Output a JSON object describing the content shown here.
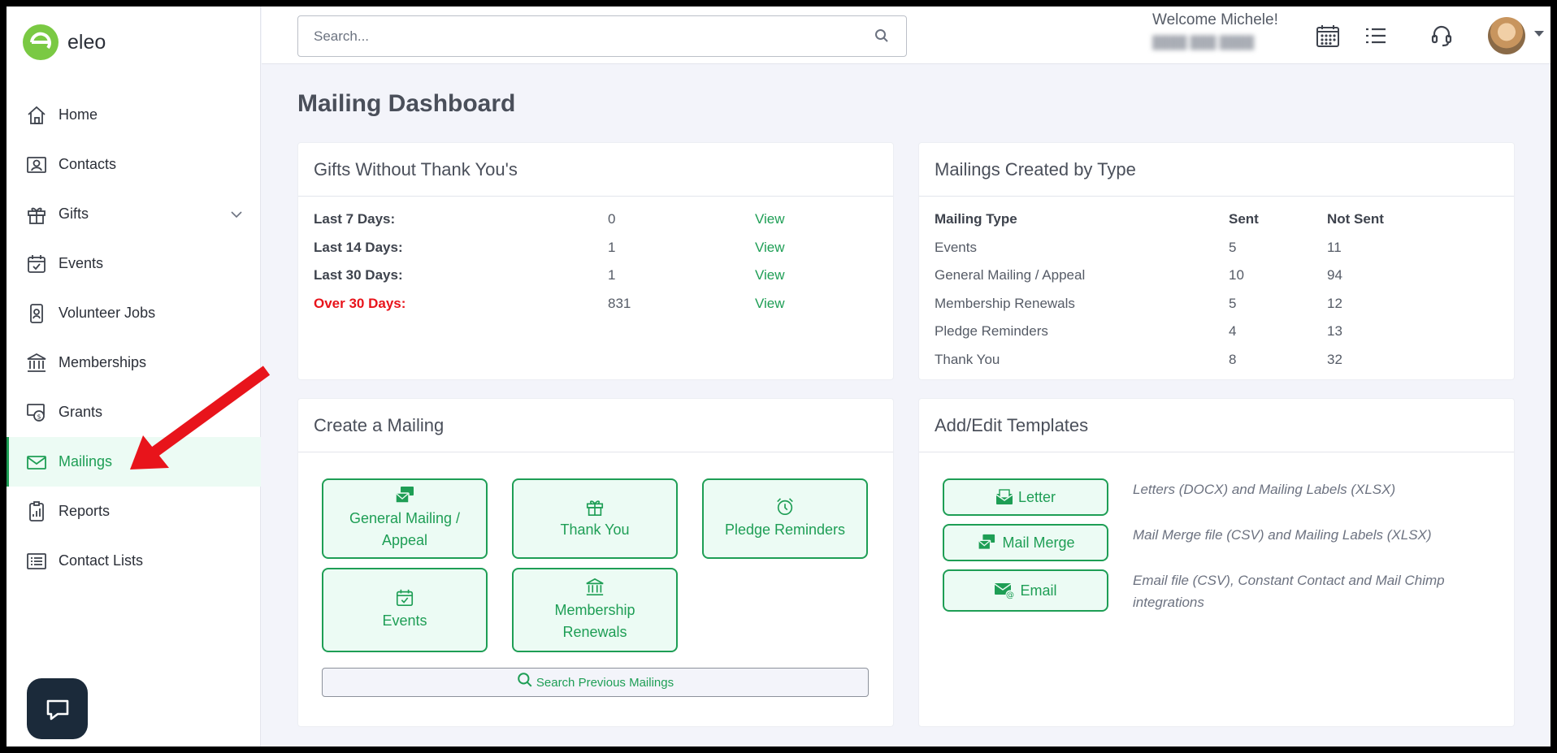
{
  "app": {
    "name": "eleo"
  },
  "sidebar": {
    "items": [
      {
        "label": "Home",
        "icon": "home-icon"
      },
      {
        "label": "Contacts",
        "icon": "contact-card-icon"
      },
      {
        "label": "Gifts",
        "icon": "gift-icon"
      },
      {
        "label": "Events",
        "icon": "calendar-check-icon"
      },
      {
        "label": "Volunteer Jobs",
        "icon": "badge-icon"
      },
      {
        "label": "Memberships",
        "icon": "bank-icon"
      },
      {
        "label": "Grants",
        "icon": "money-icon"
      },
      {
        "label": "Mailings",
        "icon": "envelope-icon",
        "active": true
      },
      {
        "label": "Reports",
        "icon": "report-icon"
      },
      {
        "label": "Contact Lists",
        "icon": "list-icon"
      }
    ]
  },
  "topbar": {
    "search_placeholder": "Search...",
    "welcome": "Welcome Michele!"
  },
  "page": {
    "title": "Mailing Dashboard"
  },
  "gifts_card": {
    "title": "Gifts Without Thank You's",
    "rows": [
      {
        "label": "Last 7 Days:",
        "count": "0",
        "link": "View"
      },
      {
        "label": "Last 14 Days:",
        "count": "1",
        "link": "View"
      },
      {
        "label": "Last 30 Days:",
        "count": "1",
        "link": "View"
      },
      {
        "label": "Over 30 Days:",
        "count": "831",
        "link": "View"
      }
    ]
  },
  "types_card": {
    "title": "Mailings Created by Type",
    "headers": [
      "Mailing Type",
      "Sent",
      "Not Sent"
    ],
    "rows": [
      {
        "type": "Events",
        "sent": "5",
        "not_sent": "11"
      },
      {
        "type": "General Mailing / Appeal",
        "sent": "10",
        "not_sent": "94"
      },
      {
        "type": "Membership Renewals",
        "sent": "5",
        "not_sent": "12"
      },
      {
        "type": "Pledge Reminders",
        "sent": "4",
        "not_sent": "13"
      },
      {
        "type": "Thank You",
        "sent": "8",
        "not_sent": "32"
      }
    ]
  },
  "create_card": {
    "title": "Create a Mailing",
    "tiles": {
      "general": {
        "line1": "General Mailing /",
        "line2": "Appeal"
      },
      "thank_you": "Thank You",
      "pledge": "Pledge Reminders",
      "events": "Events",
      "membership": {
        "line1": "Membership",
        "line2": "Renewals"
      }
    },
    "search_previous": "Search Previous Mailings"
  },
  "templates_card": {
    "title": "Add/Edit Templates",
    "items": [
      {
        "label": "Letter",
        "desc": "Letters (DOCX) and Mailing Labels (XLSX)"
      },
      {
        "label": "Mail Merge",
        "desc": "Mail Merge file (CSV) and Mailing Labels (XLSX)"
      },
      {
        "label": "Email",
        "desc": "Email file (CSV), Constant Contact and Mail Chimp integrations"
      }
    ]
  },
  "colors": {
    "accent": "#1e9e55",
    "alert": "#e8141b",
    "logo": "#7ac943",
    "annotation_arrow": "#e8141b"
  }
}
